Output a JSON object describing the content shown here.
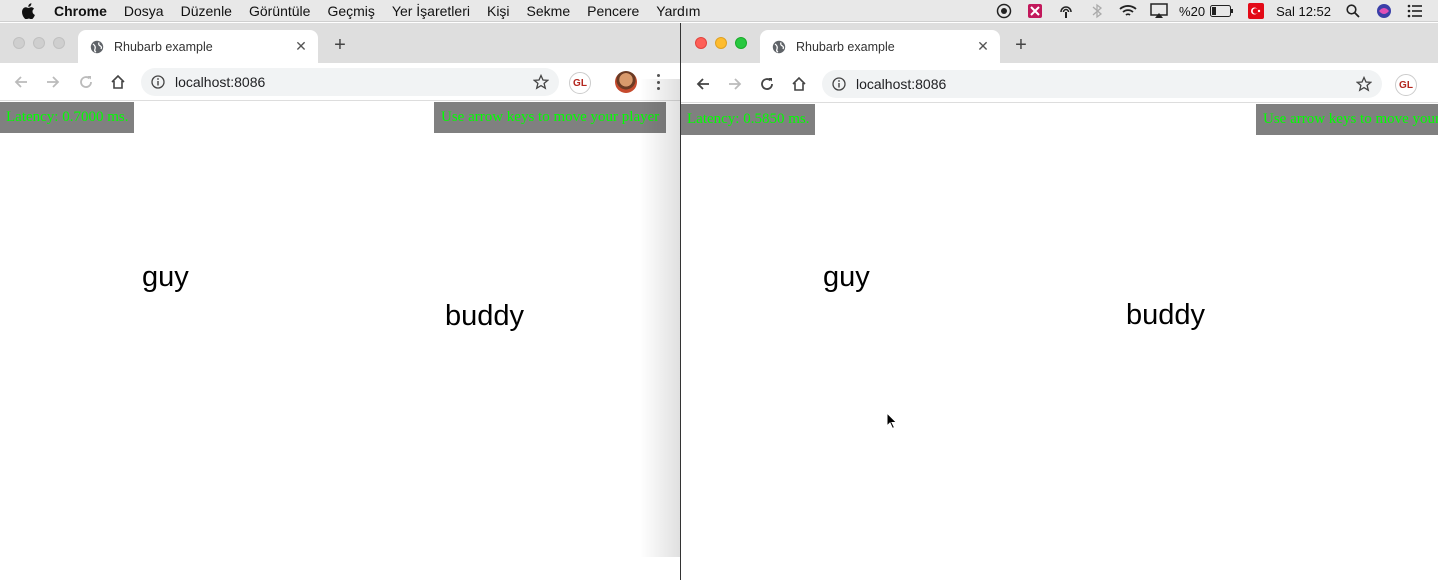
{
  "menubar": {
    "app_name": "Chrome",
    "items": [
      "Dosya",
      "Düzenle",
      "Görüntüle",
      "Geçmiş",
      "Yer İşaretleri",
      "Kişi",
      "Sekme",
      "Pencere",
      "Yardım"
    ],
    "battery_text": "%20",
    "clock": "Sal 12:52"
  },
  "left_window": {
    "tab_title": "Rhubarb example",
    "url": "localhost:8086",
    "extension_label": "GL",
    "latency_text": "Latency: 0.7000 ms.",
    "hint_text": "Use arrow keys to move your player",
    "players": [
      {
        "label": "guy"
      },
      {
        "label": "buddy"
      }
    ]
  },
  "right_window": {
    "tab_title": "Rhubarb example",
    "url": "localhost:8086",
    "extension_label": "GL",
    "latency_text": "Latency: 0.5850 ms.",
    "hint_text": "Use arrow keys to move your player",
    "players": [
      {
        "label": "guy"
      },
      {
        "label": "buddy"
      }
    ]
  },
  "colors": {
    "overlay_bg": "#808080",
    "overlay_text": "#00ff00"
  }
}
